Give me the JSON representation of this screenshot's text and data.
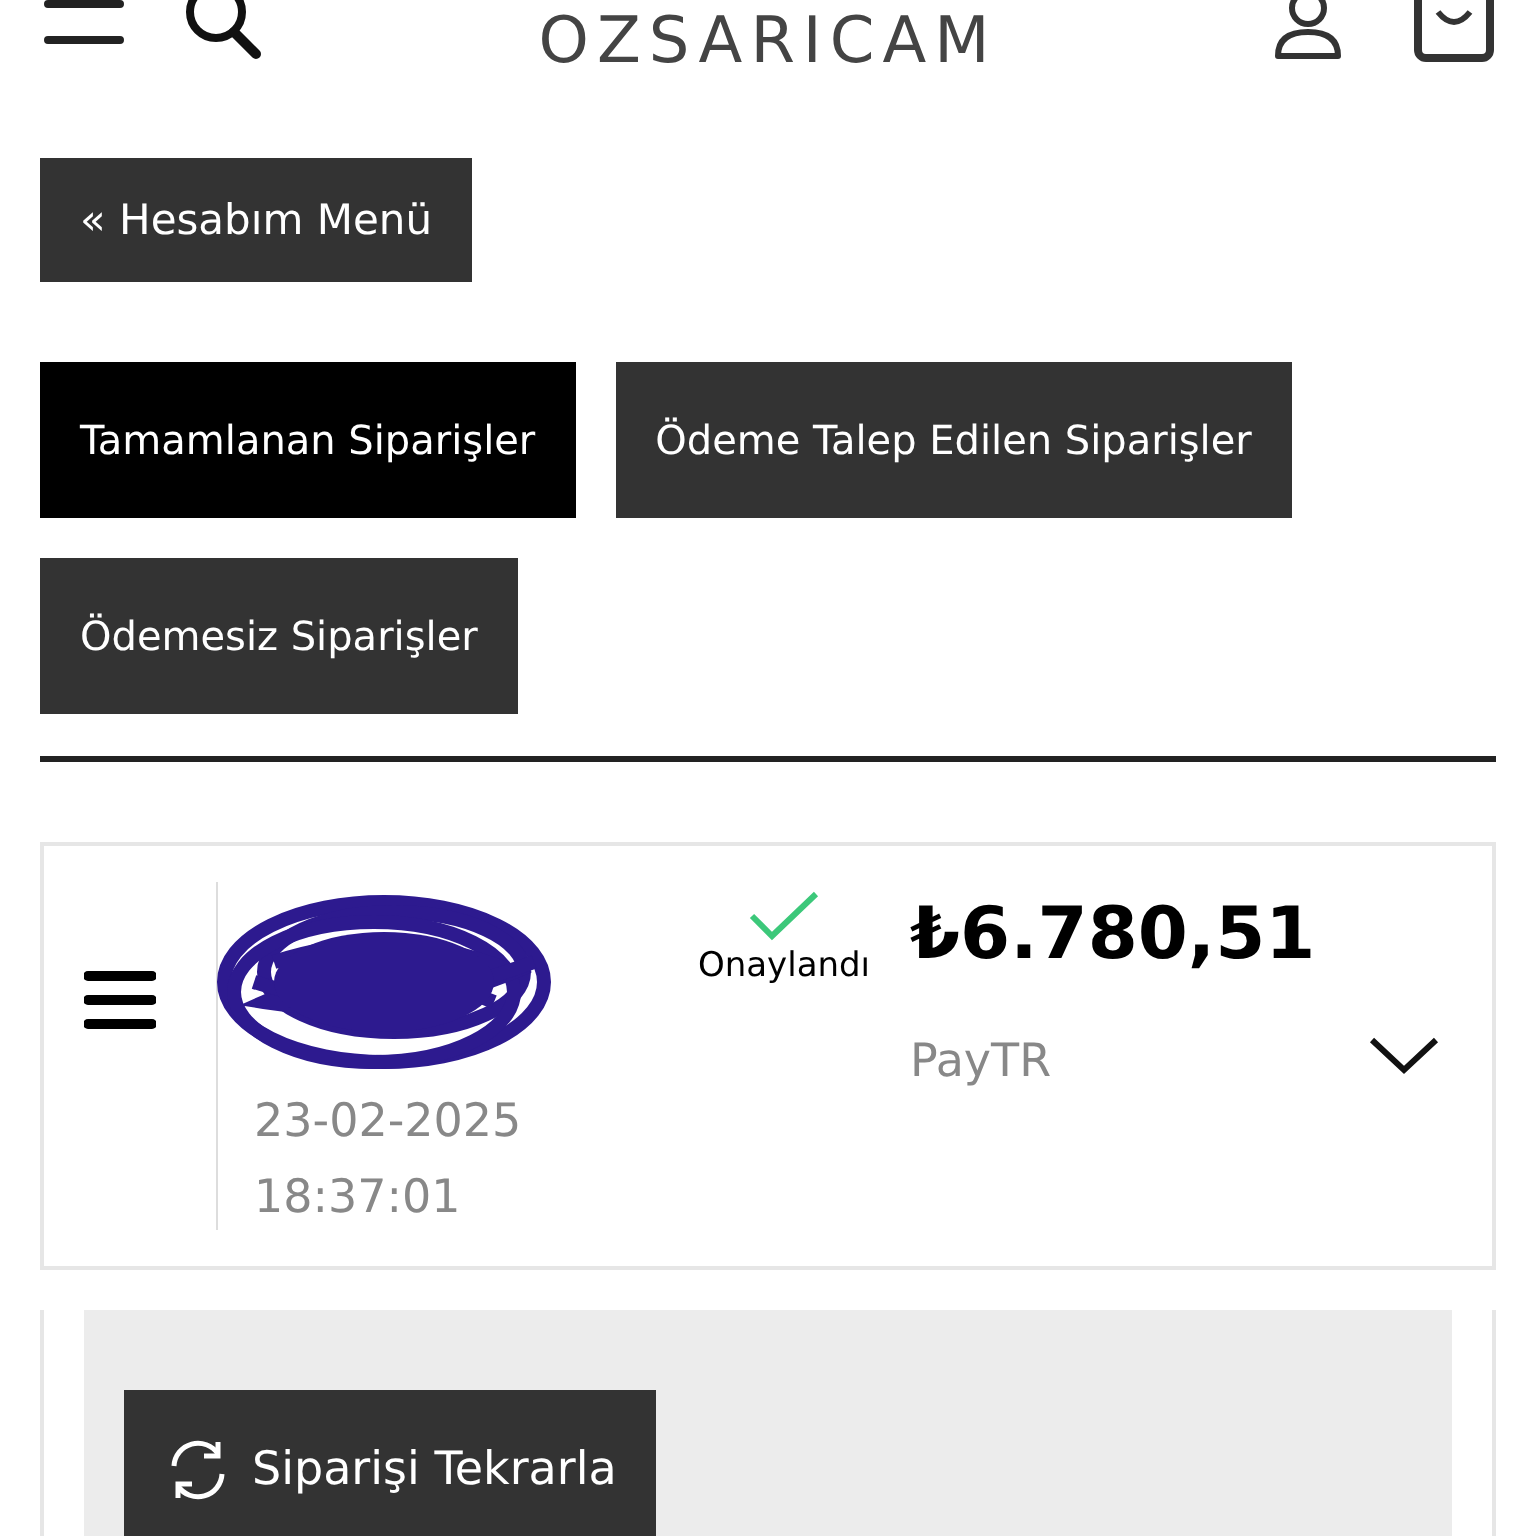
{
  "header": {
    "logo": "OZSARICAM"
  },
  "account_menu_button": {
    "label": "« Hesabım Menü"
  },
  "tabs": [
    {
      "label": "Tamamlanan Siparişler",
      "selected": true
    },
    {
      "label": "Ödeme Talep Edilen Siparişler",
      "selected": false
    },
    {
      "label": "Ödemesiz Siparişler",
      "selected": false
    }
  ],
  "orders": [
    {
      "status": "Onaylandı",
      "date": "23-02-2025",
      "time": "18:37:01",
      "amount": "₺6.780,51",
      "payment_method": "PayTR"
    }
  ],
  "reorder_button": {
    "label": "Siparişi Tekrarla"
  }
}
